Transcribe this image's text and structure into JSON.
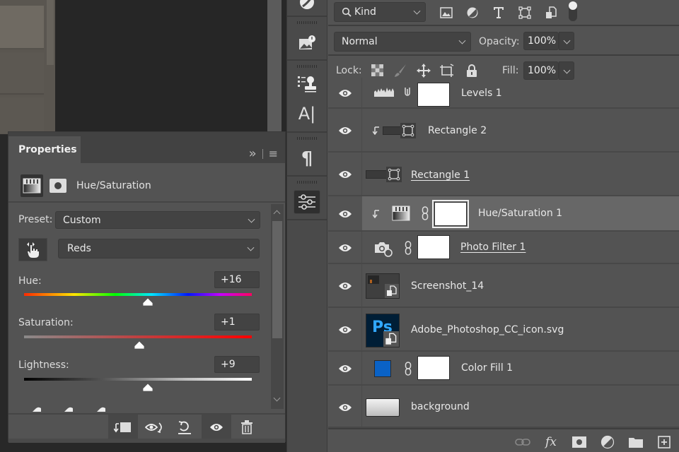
{
  "properties_panel": {
    "tab_label": "Properties",
    "collapse_glyph": "»",
    "menu_glyph": "≡",
    "adjustment_type": "Hue/Saturation",
    "preset_label": "Preset:",
    "preset_value": "Custom",
    "channel_value": "Reds",
    "hue": {
      "label": "Hue:",
      "value": "+16",
      "range": [
        -180,
        180
      ],
      "numeric": 16
    },
    "saturation": {
      "label": "Saturation:",
      "value": "+1",
      "range": [
        -100,
        100
      ],
      "numeric": 1
    },
    "lightness": {
      "label": "Lightness:",
      "value": "+9",
      "range": [
        -100,
        100
      ],
      "numeric": 9
    },
    "footer_buttons": [
      "clip-to-layer",
      "view-previous-state",
      "reset-to-defaults",
      "toggle-visibility",
      "delete-adjustment"
    ]
  },
  "tool_strip": {
    "icons": [
      "color-icon",
      "image-alert-icon",
      "clone-source-icon",
      "character-icon",
      "paragraph-icon",
      "adjustments-icon"
    ],
    "character_glyph": "A|",
    "paragraph_glyph": "¶"
  },
  "layers_panel": {
    "filter_kind": "Kind",
    "blend_mode": "Normal",
    "opacity_label": "Opacity:",
    "opacity_value": "100%",
    "lock_label": "Lock:",
    "fill_label": "Fill:",
    "fill_value": "100%",
    "layers": [
      {
        "name": "Levels 1",
        "type": "levels",
        "visible": true,
        "clipped": false,
        "underlined": false,
        "selected": false
      },
      {
        "name": "Rectangle 2",
        "type": "shape",
        "visible": true,
        "clipped": true,
        "underlined": false,
        "selected": false
      },
      {
        "name": "Rectangle 1",
        "type": "shape",
        "visible": true,
        "clipped": false,
        "underlined": true,
        "selected": false
      },
      {
        "name": "Hue/Saturation 1",
        "type": "hue-saturation",
        "visible": true,
        "clipped": true,
        "underlined": false,
        "selected": true
      },
      {
        "name": "Photo Filter 1",
        "type": "photo-filter",
        "visible": true,
        "clipped": false,
        "underlined": true,
        "selected": false
      },
      {
        "name": "Screenshot_14",
        "type": "smart-object",
        "visible": true,
        "clipped": false,
        "underlined": false,
        "selected": false
      },
      {
        "name": "Adobe_Photoshop_CC_icon.svg",
        "type": "smart-object",
        "visible": true,
        "clipped": false,
        "underlined": false,
        "selected": false
      },
      {
        "name": "Color Fill 1",
        "type": "color-fill",
        "visible": true,
        "clipped": false,
        "underlined": false,
        "selected": false,
        "fill_color": "#0a62c6"
      },
      {
        "name": "background",
        "type": "gradient",
        "visible": true,
        "clipped": false,
        "underlined": false,
        "selected": false
      }
    ],
    "footer_icons": [
      "link-layers-icon",
      "fx-icon",
      "add-mask-icon",
      "adjustment-layer-icon",
      "new-group-icon",
      "new-layer-icon"
    ],
    "fx_label": "fx"
  }
}
